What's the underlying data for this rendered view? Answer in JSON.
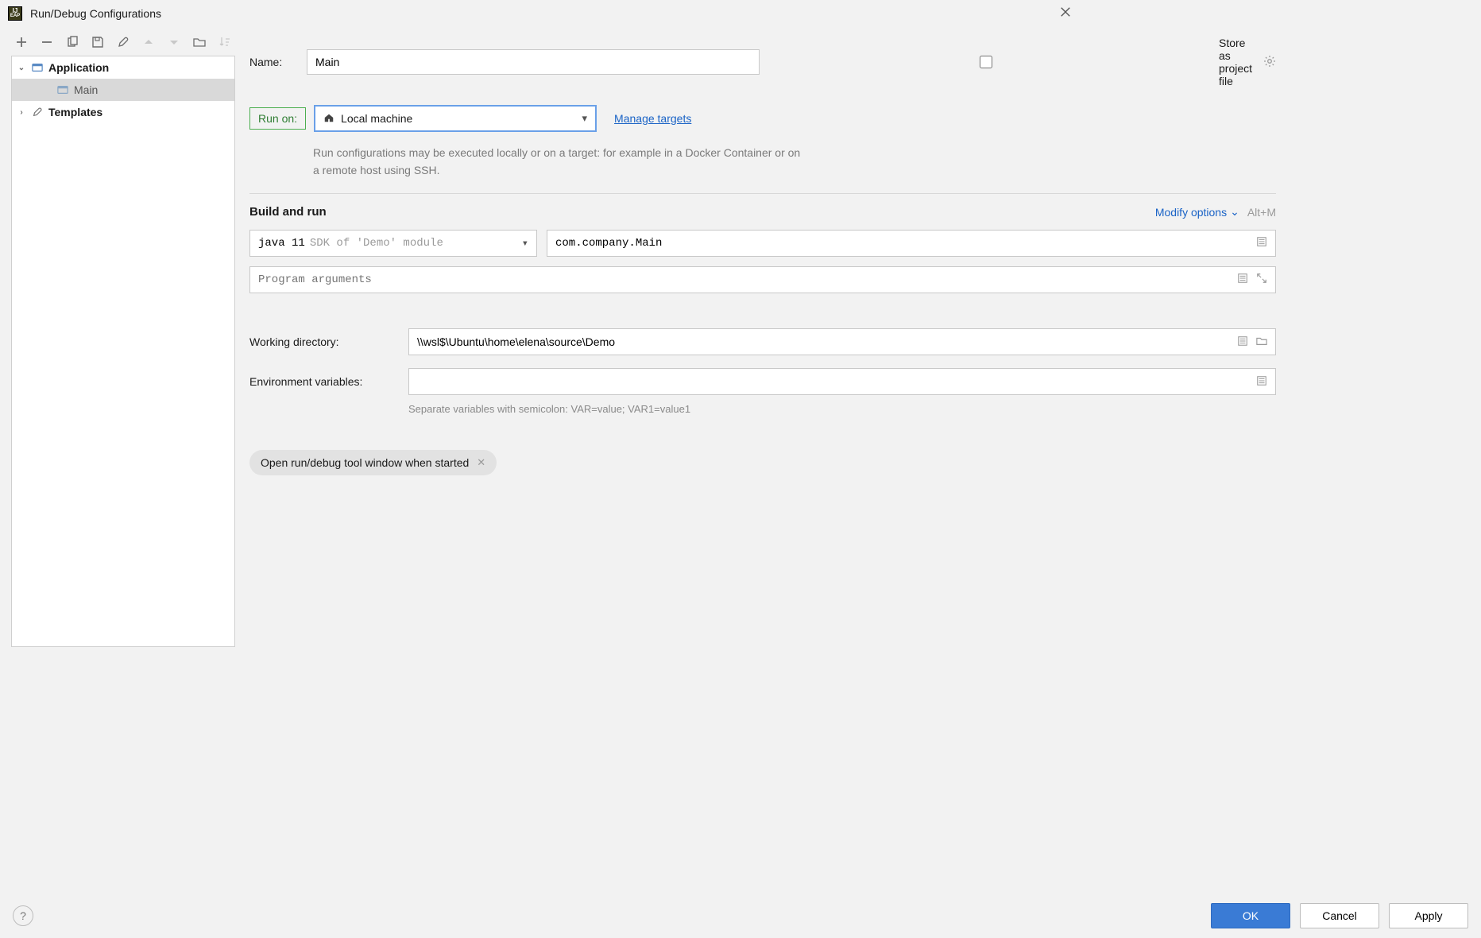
{
  "window": {
    "title": "Run/Debug Configurations"
  },
  "tree": {
    "application": "Application",
    "main": "Main",
    "templates": "Templates"
  },
  "form": {
    "name_label": "Name:",
    "name_value": "Main",
    "store_label": "Store as project file",
    "runon_label": "Run on:",
    "runon_value": "Local machine",
    "manage_targets": "Manage targets",
    "runon_hint": "Run configurations may be executed locally or on a target: for example in a Docker Container or on a remote host using SSH.",
    "build_title": "Build and run",
    "modify_options": "Modify options",
    "modify_shortcut": "Alt+M",
    "jdk_name": "java 11",
    "jdk_hint": "SDK of 'Demo' module",
    "main_class": "com.company.Main",
    "args_placeholder": "Program arguments",
    "workdir_label": "Working directory:",
    "workdir_value": "\\\\wsl$\\Ubuntu\\home\\elena\\source\\Demo",
    "env_label": "Environment variables:",
    "env_value": "",
    "env_hint": "Separate variables with semicolon: VAR=value; VAR1=value1",
    "chip_label": "Open run/debug tool window when started"
  },
  "buttons": {
    "ok": "OK",
    "cancel": "Cancel",
    "apply": "Apply"
  }
}
